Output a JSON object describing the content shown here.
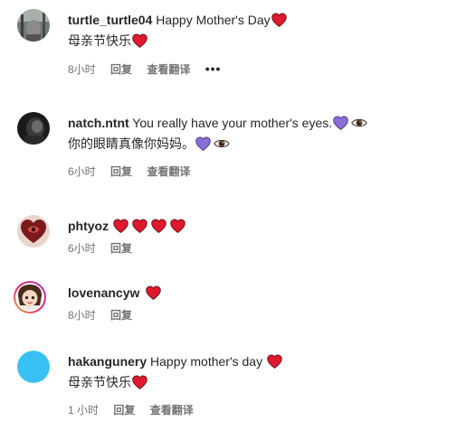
{
  "comments": [
    {
      "username": "turtle_turtle04",
      "text": "Happy Mother's Day",
      "translation": "母亲节快乐",
      "time": "8小时",
      "reply": "回复",
      "see_translation": "查看翻译",
      "more": "•••"
    },
    {
      "username": "natch.ntnt",
      "text": "You really have your mother's eyes.",
      "translation": "你的眼睛真像你妈妈。",
      "time": "6小时",
      "reply": "回复",
      "see_translation": "查看翻译"
    },
    {
      "username": "phtyoz",
      "time": "6小时",
      "reply": "回复"
    },
    {
      "username": "lovenancyw",
      "time": "8小时",
      "reply": "回复"
    },
    {
      "username": "hakangunery",
      "text": "Happy mother's day",
      "translation": "母亲节快乐",
      "time": "1 小时",
      "reply": "回复",
      "see_translation": "查看翻译"
    }
  ],
  "colors": {
    "heart_red": "#e0182d",
    "heart_purple": "#8b6fd8",
    "meta_gray": "#737373",
    "avatar_blue": "#38c1f2"
  }
}
